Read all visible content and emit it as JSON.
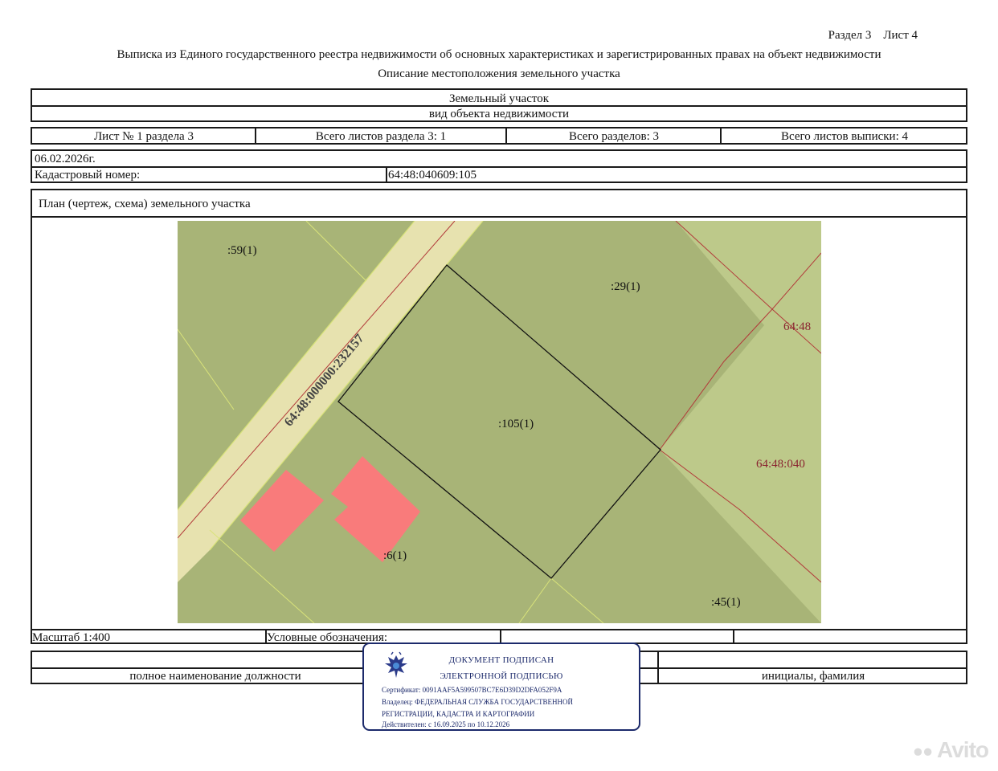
{
  "header": {
    "section_sheet": "Раздел 3    Лист 4",
    "title": "Выписка из Единого государственного реестра недвижимости об основных характеристиках и зарегистрированных правах на объект недвижимости",
    "subtitle": "Описание местоположения земельного участка"
  },
  "object": {
    "type": "Земельный участок",
    "type_caption": "вид объекта недвижимости"
  },
  "sheet_info": {
    "sheet": "Лист № 1 раздела 3",
    "total_sheets_section": "Всего листов раздела 3: 1",
    "total_sections": "Всего разделов: 3",
    "total_sheets_extract": "Всего листов выписки: 4"
  },
  "meta": {
    "date": "06.02.2026г.",
    "cadastral_label": "Кадастровый номер:",
    "cadastral_number": "64:48:040609:105"
  },
  "plan": {
    "title": "План (чертеж, схема) земельного участка",
    "colors": {
      "parcel": "#a8b477",
      "light_parcel": "#bdc98a",
      "road": "#e7e2af",
      "building": "#f97b7b",
      "red_line": "#b23a3a",
      "yellow_line": "#d9e37a"
    },
    "labels": {
      "p59": ":59(1)",
      "p29": ":29(1)",
      "p105": ":105(1)",
      "p6": ":6(1)",
      "p45": ":45(1)",
      "road": "64:48:000000:232157",
      "ext1": "64:48",
      "ext2": "64:48:040"
    }
  },
  "footer": {
    "scale": "Масштаб 1:400",
    "legend": "Условные обозначения:",
    "position": "полное наименование должности",
    "initials": "инициалы, фамилия"
  },
  "stamp": {
    "line1": "ДОКУМЕНТ ПОДПИСАН",
    "line2": "ЭЛЕКТРОННОЙ ПОДПИСЬЮ",
    "certificate": "Сертификат: 0091AAF5A599507BC7E6D39D2DFA052F9A",
    "owner1": "Владелец: ФЕДЕРАЛЬНАЯ СЛУЖБА ГОСУДАРСТВЕННОЙ",
    "owner2": "РЕГИСТРАЦИИ, КАДАСТРА И КАРТОГРАФИИ",
    "validity": "Действителен: с 16.09.2025 по 10.12.2026",
    "emblem_icon": "double-headed-eagle-icon"
  },
  "watermark": {
    "text": "Avito",
    "icon": "avito-logo-icon"
  }
}
